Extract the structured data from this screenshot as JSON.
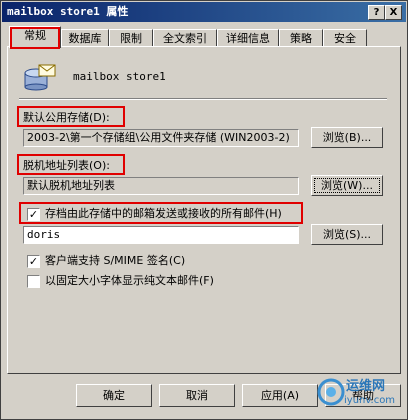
{
  "window": {
    "title": "mailbox store1 属性",
    "help_btn": "?",
    "close_btn": "X"
  },
  "tabs": [
    {
      "label": "常规"
    },
    {
      "label": "数据库"
    },
    {
      "label": "限制"
    },
    {
      "label": "全文索引"
    },
    {
      "label": "详细信息"
    },
    {
      "label": "策略"
    },
    {
      "label": "安全"
    }
  ],
  "general": {
    "store_name": "mailbox store1",
    "default_public_store_label": "默认公用存储(D):",
    "default_public_store_value": "2003-2\\第一个存储组\\公用文件夹存储 (WIN2003-2)",
    "browse_b": "浏览(B)...",
    "offline_address_list_label": "脱机地址列表(O):",
    "offline_address_list_value": "默认脱机地址列表",
    "browse_w": "浏览(W)...",
    "archive_label": "存档由此存储中的邮箱发送或接收的所有邮件(H)",
    "archive_checked": true,
    "archive_target": "doris",
    "browse_s": "浏览(S)...",
    "smime_label": "客户端支持 S/MIME 签名(C)",
    "smime_checked": true,
    "fixed_font_label": "以固定大小字体显示纯文本邮件(F)",
    "fixed_font_checked": false
  },
  "footer": {
    "ok": "确定",
    "cancel": "取消",
    "apply": "应用(A)",
    "help": "帮助"
  },
  "watermark": {
    "text": "运维网",
    "url": "iyunv.com"
  },
  "colors": {
    "title_bar": "#0a246a",
    "face": "#d4d0c8",
    "highlight": "#e00000"
  }
}
